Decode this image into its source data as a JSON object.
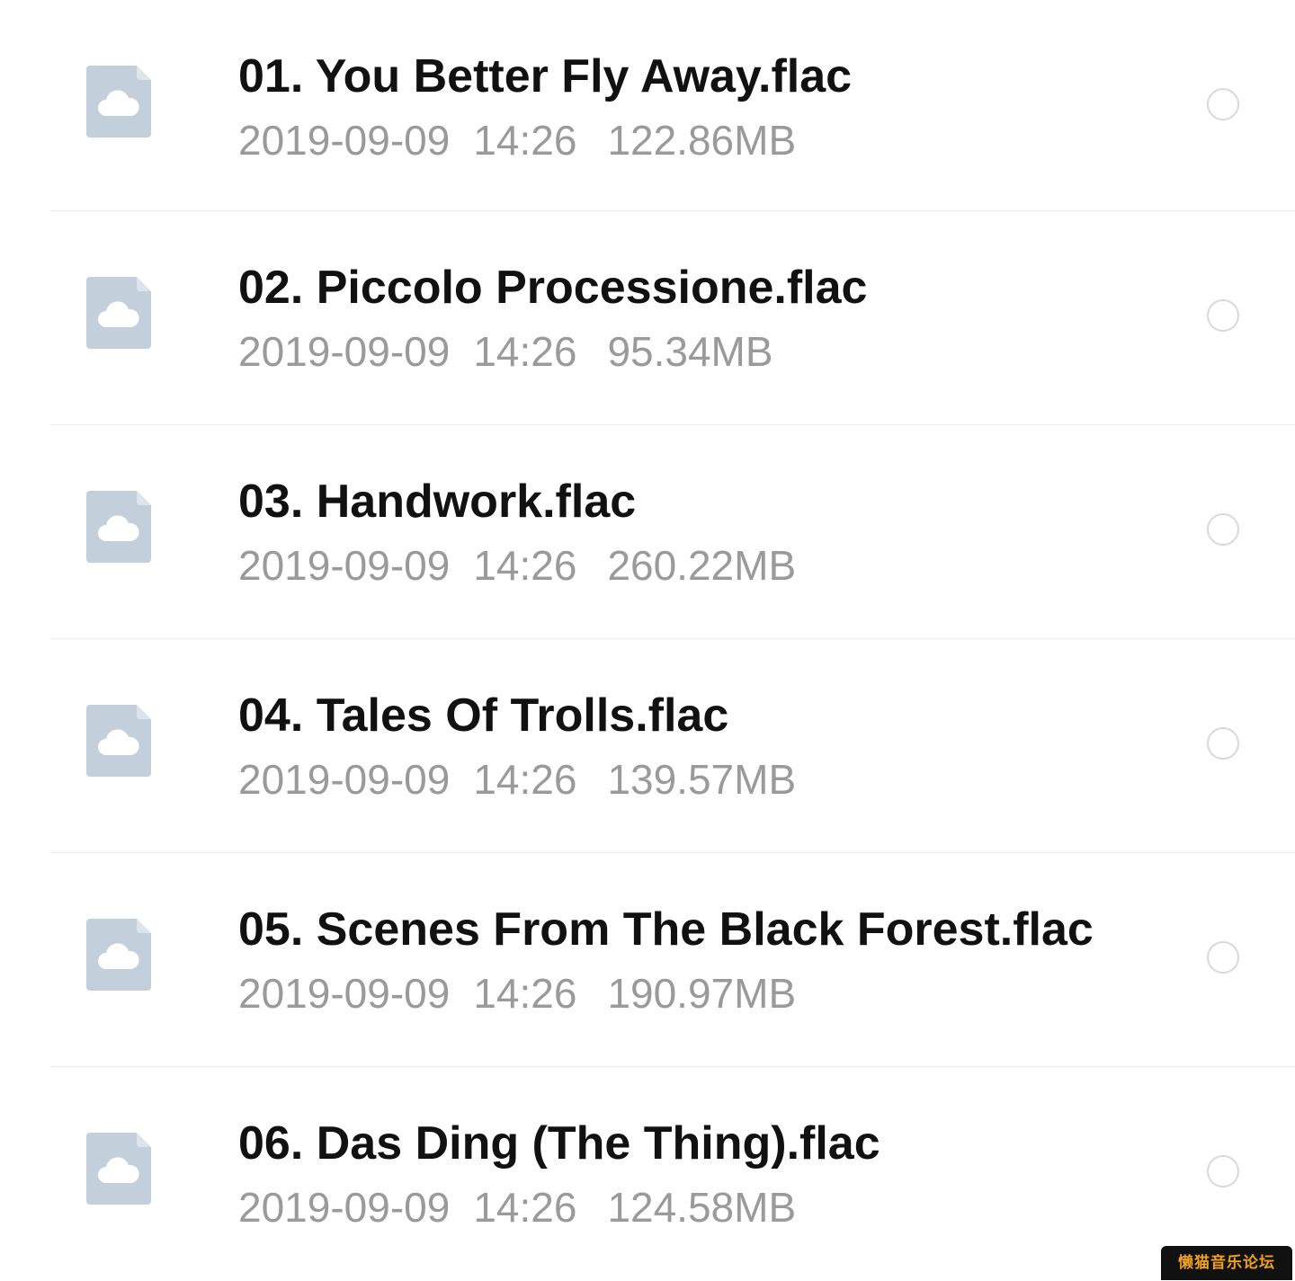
{
  "files": [
    {
      "name": "01. You Better Fly Away.flac",
      "date": "2019-09-09",
      "time": "14:26",
      "size": "122.86MB",
      "icon": "cloud-file-icon"
    },
    {
      "name": "02. Piccolo Processione.flac",
      "date": "2019-09-09",
      "time": "14:26",
      "size": "95.34MB",
      "icon": "cloud-file-icon"
    },
    {
      "name": "03. Handwork.flac",
      "date": "2019-09-09",
      "time": "14:26",
      "size": "260.22MB",
      "icon": "cloud-file-icon"
    },
    {
      "name": "04. Tales Of Trolls.flac",
      "date": "2019-09-09",
      "time": "14:26",
      "size": "139.57MB",
      "icon": "cloud-file-icon"
    },
    {
      "name": "05. Scenes From The Black Forest.flac",
      "date": "2019-09-09",
      "time": "14:26",
      "size": "190.97MB",
      "icon": "cloud-file-icon"
    },
    {
      "name": "06. Das Ding (The Thing).flac",
      "date": "2019-09-09",
      "time": "14:26",
      "size": "124.58MB",
      "icon": "cloud-file-icon"
    }
  ],
  "watermark": {
    "text": "懒猫音乐论坛"
  },
  "colors": {
    "file_icon": "#c3cfdb",
    "file_icon_fold": "#dde5ec",
    "name_text": "#111111",
    "meta_text": "#9a9a9a",
    "radio_border": "#d9d9d9",
    "divider": "#ececec",
    "watermark_bg": "#111111",
    "watermark_text": "#f0a020"
  }
}
